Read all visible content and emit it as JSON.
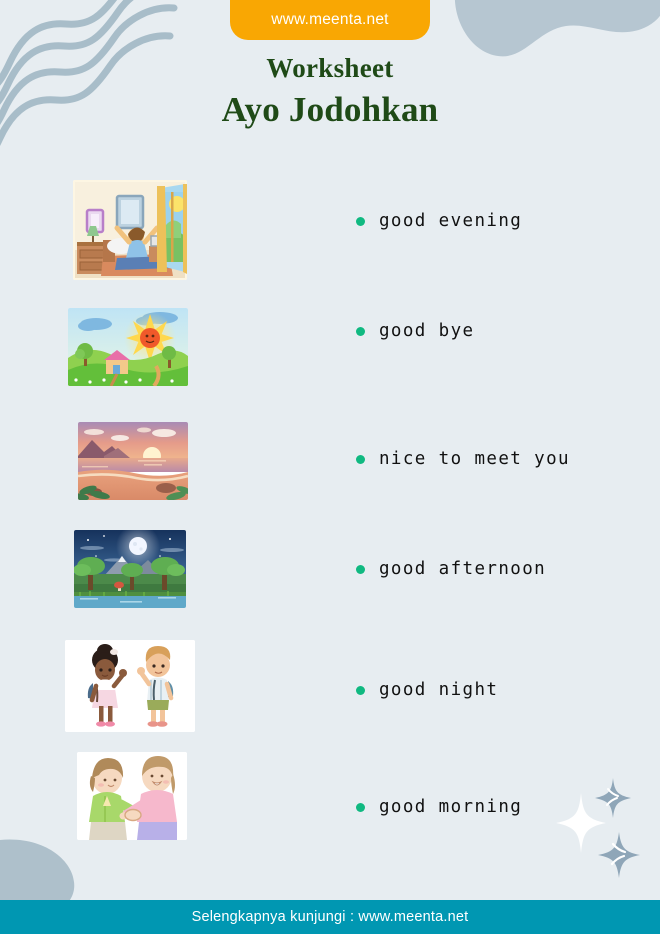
{
  "header": {
    "url_badge": "www.meenta.net",
    "title_line1": "Worksheet",
    "title_line2": "Ayo Jodohkan"
  },
  "footer": {
    "text": "Selengkapnya kunjungi : www.meenta.net"
  },
  "colors": {
    "background": "#e7edf1",
    "badge_orange": "#f9a703",
    "title_green": "#1f4a17",
    "bullet_green": "#10b981",
    "footer_teal": "#0097b2",
    "decoration_blue_gray": "#b0c1cc"
  },
  "pictures": [
    {
      "id": "picture-waking-up-bedroom",
      "description": "Person waking up stretching in bed, bedroom with open window and sunshine"
    },
    {
      "id": "picture-sunny-landscape",
      "description": "Sunny green hills with house, smiling sun, clouds and flowers"
    },
    {
      "id": "picture-sunset-beach",
      "description": "Sunset over the sea with mountains and pink orange sky"
    },
    {
      "id": "picture-night-moon",
      "description": "Night scene with full moon, trees, mountains and river"
    },
    {
      "id": "picture-kids-waving",
      "description": "Two children with backpacks waving goodbye"
    },
    {
      "id": "picture-handshake",
      "description": "Two people smiling and shaking hands"
    }
  ],
  "answers": [
    {
      "id": "answer-good-evening",
      "label": "good evening"
    },
    {
      "id": "answer-good-bye",
      "label": "good bye"
    },
    {
      "id": "answer-nice-to-meet-you",
      "label": "nice to meet you"
    },
    {
      "id": "answer-good-afternoon",
      "label": "good afternoon"
    },
    {
      "id": "answer-good-night",
      "label": "good night"
    },
    {
      "id": "answer-good-morning",
      "label": "good morning"
    }
  ]
}
